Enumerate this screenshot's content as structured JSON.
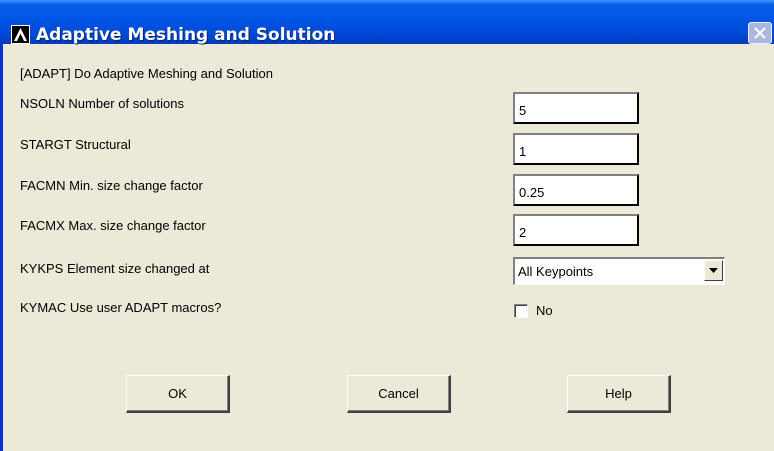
{
  "window": {
    "title": "Adaptive Meshing and Solution",
    "subtitle": "[ADAPT] Do Adaptive Meshing and Solution"
  },
  "fields": {
    "nsoln": {
      "label": "NSOLN  Number of solutions",
      "value": "5"
    },
    "stargt": {
      "label": "STARGT Structural",
      "value": "1"
    },
    "facmn": {
      "label": "FACMN  Min. size change factor",
      "value": "0.25"
    },
    "facmx": {
      "label": "FACMX  Max. size change factor",
      "value": "2"
    },
    "kykps": {
      "label": "KYKPS  Element size changed at",
      "value": "All Keypoints"
    },
    "kymac": {
      "label": "KYMAC  Use user ADAPT macros?",
      "checkbox_label": "No",
      "checked": false
    }
  },
  "buttons": {
    "ok": "OK",
    "cancel": "Cancel",
    "help": "Help"
  },
  "icons": {
    "app": "ansys-logo-icon",
    "close": "close-icon",
    "dropdown": "chevron-down-icon"
  },
  "colors": {
    "titlebar": "#0055e5",
    "dialog_bg": "#ece9d8"
  }
}
